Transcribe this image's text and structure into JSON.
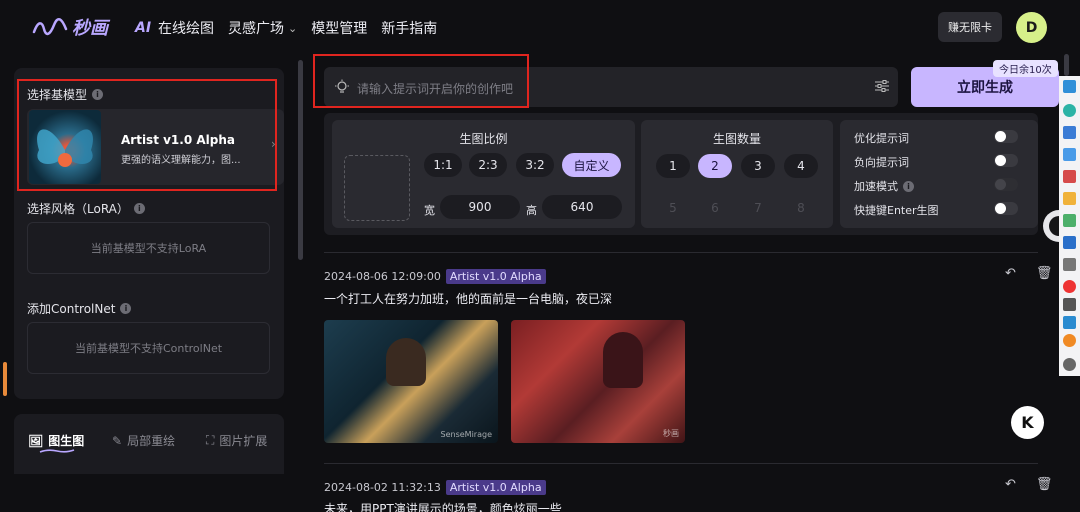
{
  "app": {
    "logo_text": "秒画",
    "nav": [
      {
        "ai": "AI",
        "label": "在线绘图"
      },
      {
        "label": "灵感广场"
      },
      {
        "label": "模型管理"
      },
      {
        "label": "新手指南"
      }
    ],
    "card_button": "赚无限卡",
    "avatar_letter": "D",
    "brand_color": "#c8b6ff"
  },
  "left": {
    "base_model_title": "选择基模型",
    "model_name": "Artist v1.0 Alpha",
    "model_desc": "更强的语义理解能力，图...",
    "lora_title": "选择风格（LoRA）",
    "lora_empty": "当前基模型不支持LoRA",
    "controlnet_title": "添加ControlNet",
    "controlnet_empty": "当前基模型不支持ControlNet",
    "tabs": [
      "图生图",
      "局部重绘",
      "图片扩展"
    ]
  },
  "prompt": {
    "placeholder": "请输入提示词开启你的创作吧",
    "generate": "立即生成",
    "quota": "今日余10次"
  },
  "options": {
    "ratio_title": "生图比例",
    "ratios": [
      "1:1",
      "2:3",
      "3:2",
      "自定义"
    ],
    "selected_ratio": "自定义",
    "width_label": "宽",
    "width": "900",
    "height_label": "高",
    "height": "640",
    "count_title": "生图数量",
    "counts": [
      "1",
      "2",
      "3",
      "4",
      "5",
      "6",
      "7",
      "8"
    ],
    "selected_count": "2",
    "toggles": [
      {
        "label": "优化提示词",
        "on": false
      },
      {
        "label": "负向提示词",
        "on": false
      },
      {
        "label": "加速模式",
        "on": false,
        "disabled": true
      },
      {
        "label": "快捷键Enter生图",
        "on": false
      }
    ]
  },
  "history": [
    {
      "time": "2024-08-06 12:09:00",
      "model": "Artist v1.0 Alpha",
      "prompt": "一个打工人在努力加班，他的面前是一台电脑，夜已深"
    },
    {
      "time": "2024-08-02 11:32:13",
      "model": "Artist v1.0 Alpha",
      "prompt": "未来，用PPT演讲展示的场景，颜色炫丽一些"
    }
  ],
  "watermarks": [
    "SenseMirage",
    "秒画"
  ],
  "k_badge": "K"
}
